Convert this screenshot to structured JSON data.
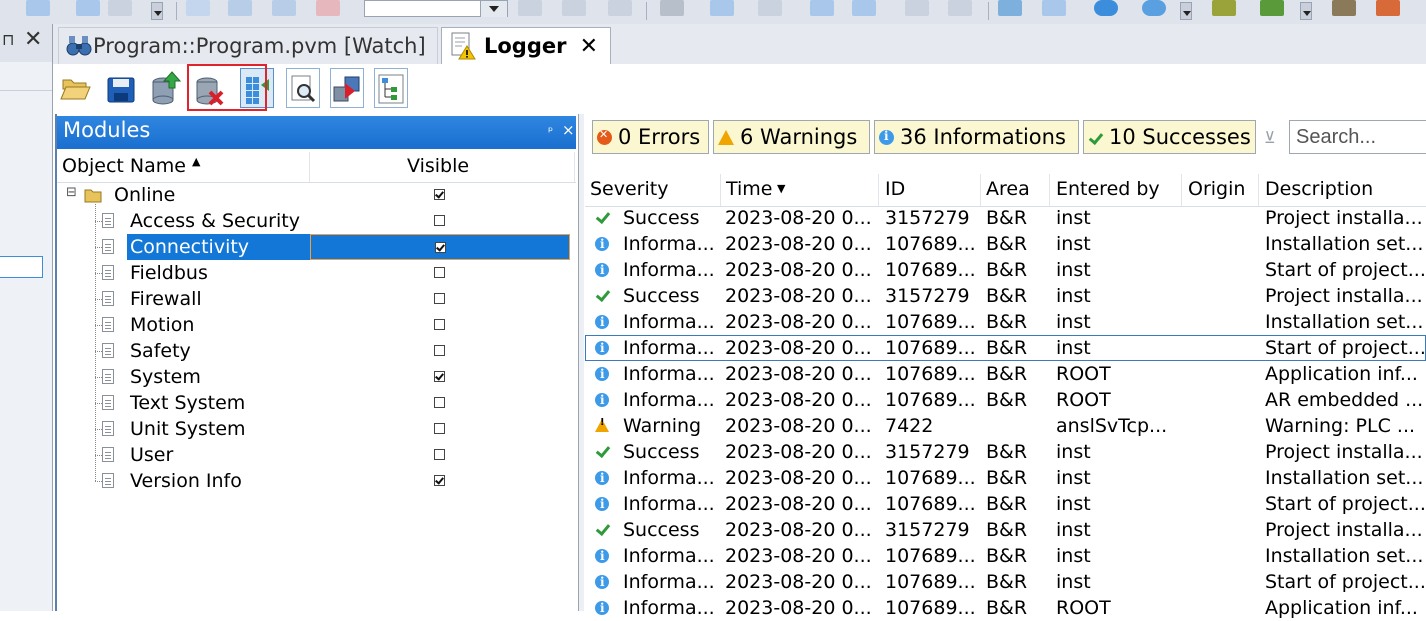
{
  "tabs": [
    {
      "label": "Program::Program.pvm [Watch]",
      "icon": "watch-binoculars-icon"
    },
    {
      "label": "Logger",
      "icon": "logger-document-warning-icon",
      "close": "✕"
    }
  ],
  "left_panel": {
    "pin": "⊓",
    "close": "✕"
  },
  "logger_toolbar": [
    {
      "name": "open-folder-button",
      "icon": "open-folder-icon"
    },
    {
      "name": "save-button",
      "icon": "save-disk-icon"
    },
    {
      "name": "upload-button",
      "icon": "upload-database-icon"
    },
    {
      "name": "clear-log-button",
      "icon": "clear-log-icon"
    },
    {
      "name": "columns-button",
      "icon": "columns-add-icon"
    },
    {
      "name": "find-button",
      "icon": "find-magnifier-icon"
    },
    {
      "name": "transfer-button",
      "icon": "transfer-icon"
    },
    {
      "name": "tree-view-button",
      "icon": "tree-view-icon"
    }
  ],
  "modules": {
    "title": "Modules",
    "pin": "ᵖ",
    "close": "×",
    "col_name": "Object Name",
    "col_sort": "▲",
    "col_visible": "Visible",
    "root": {
      "label": "Online",
      "expander": "⊟",
      "visible": true
    },
    "items": [
      {
        "label": "Access & Security",
        "visible": false
      },
      {
        "label": "Connectivity",
        "visible": true,
        "selected": true
      },
      {
        "label": "Fieldbus",
        "visible": false
      },
      {
        "label": "Firewall",
        "visible": false
      },
      {
        "label": "Motion",
        "visible": false
      },
      {
        "label": "Safety",
        "visible": false
      },
      {
        "label": "System",
        "visible": true
      },
      {
        "label": "Text System",
        "visible": false
      },
      {
        "label": "Unit System",
        "visible": false
      },
      {
        "label": "User",
        "visible": false
      },
      {
        "label": "Version Info",
        "visible": true
      }
    ]
  },
  "filters": {
    "errors": "0 Errors",
    "warnings": "6 Warnings",
    "informations": "36 Informations",
    "successes": "10 Successes",
    "search_placeholder": "Search..."
  },
  "log": {
    "columns": [
      "Severity",
      "Time",
      "ID",
      "Area",
      "Entered by",
      "Origin",
      "Description"
    ],
    "time_sort": "▼",
    "rows": [
      {
        "sev": "ok",
        "severity": "Success",
        "time": "2023-08-20 0...",
        "id": "3157279",
        "area": "B&R",
        "by": "inst",
        "origin": "",
        "desc": "Project installa..."
      },
      {
        "sev": "inf",
        "severity": "Informa...",
        "time": "2023-08-20 0...",
        "id": "107689...",
        "area": "B&R",
        "by": "inst",
        "origin": "",
        "desc": "Installation set..."
      },
      {
        "sev": "inf",
        "severity": "Informa...",
        "time": "2023-08-20 0...",
        "id": "107689...",
        "area": "B&R",
        "by": "inst",
        "origin": "",
        "desc": "Start of project..."
      },
      {
        "sev": "ok",
        "severity": "Success",
        "time": "2023-08-20 0...",
        "id": "3157279",
        "area": "B&R",
        "by": "inst",
        "origin": "",
        "desc": "Project installa..."
      },
      {
        "sev": "inf",
        "severity": "Informa...",
        "time": "2023-08-20 0...",
        "id": "107689...",
        "area": "B&R",
        "by": "inst",
        "origin": "",
        "desc": "Installation set..."
      },
      {
        "sev": "inf",
        "severity": "Informa...",
        "time": "2023-08-20 0...",
        "id": "107689...",
        "area": "B&R",
        "by": "inst",
        "origin": "",
        "desc": "Start of project...",
        "focused": true
      },
      {
        "sev": "inf",
        "severity": "Informa...",
        "time": "2023-08-20 0...",
        "id": "107689...",
        "area": "B&R",
        "by": "ROOT",
        "origin": "",
        "desc": "Application inf..."
      },
      {
        "sev": "inf",
        "severity": "Informa...",
        "time": "2023-08-20 0...",
        "id": "107689...",
        "area": "B&R",
        "by": "ROOT",
        "origin": "",
        "desc": "AR embedded ..."
      },
      {
        "sev": "warn",
        "severity": "Warning",
        "time": "2023-08-20 0...",
        "id": "7422",
        "area": "",
        "by": "anslSvTcp...",
        "origin": "",
        "desc": "Warning: PLC ..."
      },
      {
        "sev": "ok",
        "severity": "Success",
        "time": "2023-08-20 0...",
        "id": "3157279",
        "area": "B&R",
        "by": "inst",
        "origin": "",
        "desc": "Project installa..."
      },
      {
        "sev": "inf",
        "severity": "Informa...",
        "time": "2023-08-20 0...",
        "id": "107689...",
        "area": "B&R",
        "by": "inst",
        "origin": "",
        "desc": "Installation set..."
      },
      {
        "sev": "inf",
        "severity": "Informa...",
        "time": "2023-08-20 0...",
        "id": "107689...",
        "area": "B&R",
        "by": "inst",
        "origin": "",
        "desc": "Start of project..."
      },
      {
        "sev": "ok",
        "severity": "Success",
        "time": "2023-08-20 0...",
        "id": "3157279",
        "area": "B&R",
        "by": "inst",
        "origin": "",
        "desc": "Project installa..."
      },
      {
        "sev": "inf",
        "severity": "Informa...",
        "time": "2023-08-20 0...",
        "id": "107689...",
        "area": "B&R",
        "by": "inst",
        "origin": "",
        "desc": "Installation set..."
      },
      {
        "sev": "inf",
        "severity": "Informa...",
        "time": "2023-08-20 0...",
        "id": "107689...",
        "area": "B&R",
        "by": "inst",
        "origin": "",
        "desc": "Start of project..."
      },
      {
        "sev": "inf",
        "severity": "Informa...",
        "time": "2023-08-20 0...",
        "id": "107689...",
        "area": "B&R",
        "by": "ROOT",
        "origin": "",
        "desc": "Application inf..."
      }
    ]
  }
}
